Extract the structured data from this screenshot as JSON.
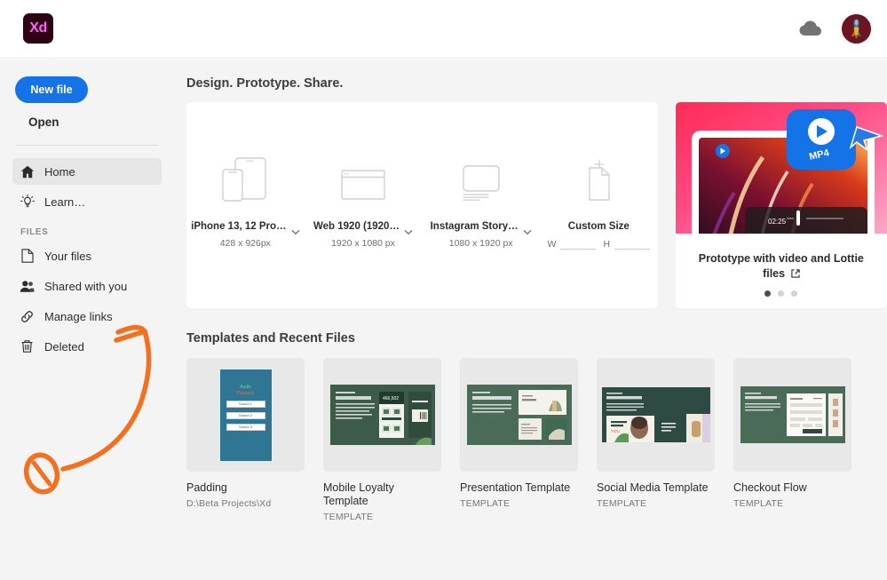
{
  "header": {
    "logo_text": "Xd",
    "cloud_icon": "cloud-icon",
    "avatar_icon": "user-avatar"
  },
  "sidebar": {
    "new_file_label": "New file",
    "open_label": "Open",
    "files_section_label": "FILES",
    "items": [
      {
        "label": "Home",
        "icon": "home-icon",
        "active": true
      },
      {
        "label": "Learn…",
        "icon": "lightbulb-icon",
        "active": false
      },
      {
        "label": "Your files",
        "icon": "document-icon",
        "active": false
      },
      {
        "label": "Shared with you",
        "icon": "people-icon",
        "active": false
      },
      {
        "label": "Manage links",
        "icon": "link-icon",
        "active": false
      },
      {
        "label": "Deleted",
        "icon": "trash-icon",
        "active": false
      }
    ]
  },
  "main": {
    "design_heading": "Design. Prototype. Share.",
    "templates_heading": "Templates and Recent Files",
    "presets": [
      {
        "name": "iPhone 13, 12 Pro…",
        "dims": "428 x 926px",
        "icon": "phone-tablet-icon",
        "has_chevron": true
      },
      {
        "name": "Web 1920 (1920…",
        "dims": "1920 x 1080 px",
        "icon": "browser-window-icon",
        "has_chevron": true
      },
      {
        "name": "Instagram Story…",
        "dims": "1080 x 1920 px",
        "icon": "instagram-story-icon",
        "has_chevron": true
      },
      {
        "name": "Custom Size",
        "dims": "",
        "icon": "custom-size-icon",
        "has_chevron": false
      }
    ],
    "custom_size": {
      "width_label": "W",
      "height_label": "H",
      "width_value": "",
      "height_value": ""
    },
    "promo": {
      "title": "Prototype with video and Lottie files",
      "badge_label": "MP4",
      "timestamp": "02:25",
      "external_link_icon": "external-link-icon",
      "dots": 3,
      "active_dot": 0
    },
    "templates": [
      {
        "name": "Padding",
        "sub": "D:\\Beta Projects\\Xd",
        "thumb": "padding-artboard"
      },
      {
        "name": "Mobile Loyalty Template",
        "sub": "TEMPLATE",
        "thumb": "mobile-loyalty-artboard"
      },
      {
        "name": "Presentation Template",
        "sub": "TEMPLATE",
        "thumb": "presentation-artboard"
      },
      {
        "name": "Social Media Template",
        "sub": "TEMPLATE",
        "thumb": "social-media-artboard"
      },
      {
        "name": "Checkout Flow",
        "sub": "TEMPLATE",
        "thumb": "checkout-artboard"
      }
    ],
    "padding_thumb": {
      "title_1": "Audio",
      "title_2": "Playback",
      "buttons": [
        "Sound 1",
        "Sound 2",
        "Sound 3"
      ]
    }
  },
  "annotation": {
    "color": "#f4701e",
    "shape": "arrow-pointing-to-manage-links"
  },
  "colors": {
    "accent_blue": "#1473e6",
    "xd_magenta": "#ff61f6",
    "xd_dark": "#2e0014",
    "annotation_orange": "#f4701e",
    "page_bg": "#f4f4f4"
  }
}
